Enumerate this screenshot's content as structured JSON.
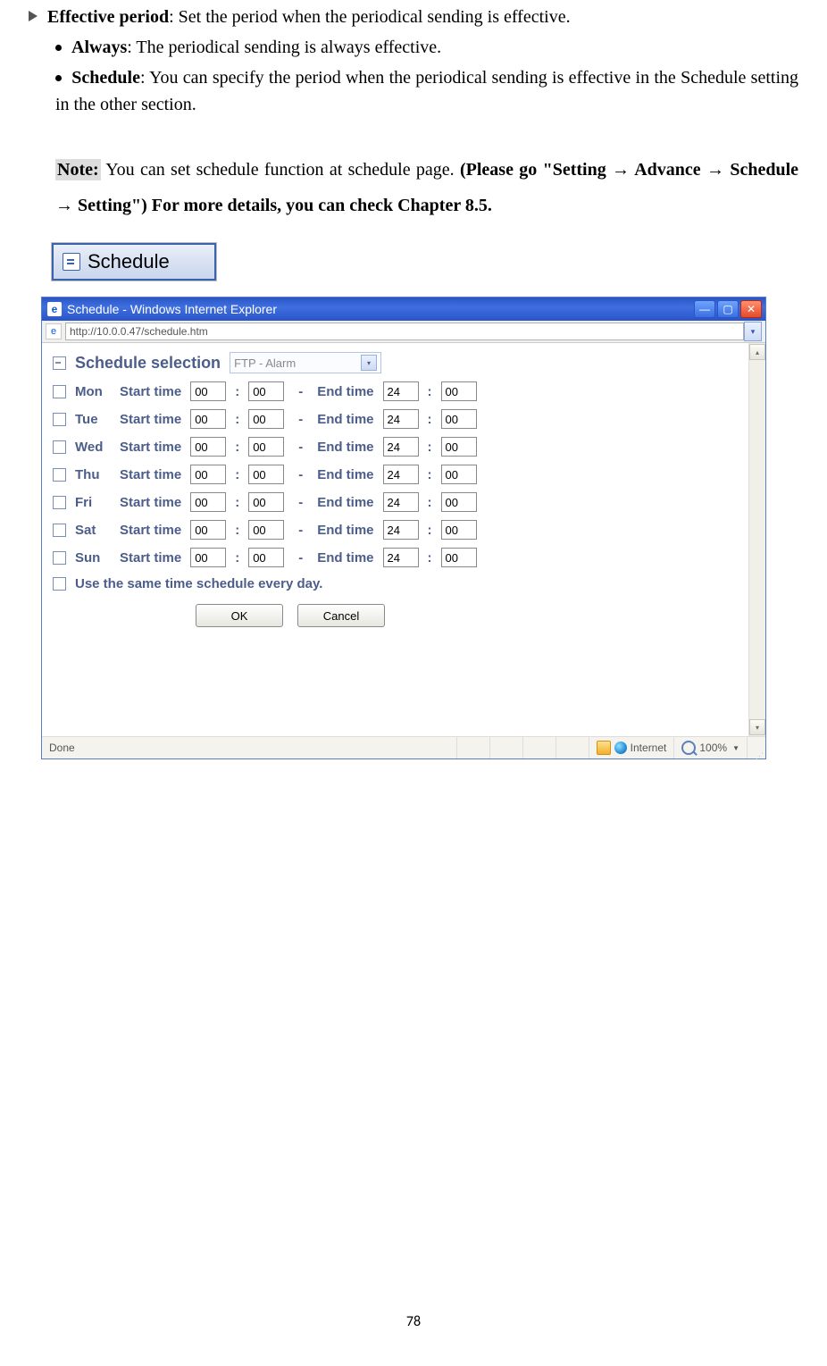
{
  "doc": {
    "line_effective": {
      "label": "Effective period",
      "text": ": Set the period when the periodical sending is effective."
    },
    "line_always": {
      "label": "Always",
      "text": ": The periodical sending is always effective."
    },
    "line_schedule": {
      "label": "Schedule",
      "text": ": You can specify the period when the periodical sending is effective in the Schedule setting in the other section."
    },
    "note_label": "Note:",
    "note_text1": " You can set schedule function at schedule page. ",
    "note_text2": "(Please go \"Setting → Advance → Schedule → Setting\") For more details, you can check Chapter 8.5.",
    "page_num": "78"
  },
  "tab_button": {
    "text": "Schedule"
  },
  "ie": {
    "title": "Schedule - Windows Internet Explorer",
    "url": "http://10.0.0.47/schedule.htm",
    "section_title": "Schedule selection",
    "select_value": "FTP - Alarm",
    "start_label": "Start time",
    "end_label": "End time",
    "same_label": "Use the same time schedule every day.",
    "ok": "OK",
    "cancel": "Cancel",
    "status_done": "Done",
    "status_zone": "Internet",
    "status_zoom": "100%",
    "days": [
      {
        "name": "Mon",
        "sh": "00",
        "sm": "00",
        "eh": "24",
        "em": "00"
      },
      {
        "name": "Tue",
        "sh": "00",
        "sm": "00",
        "eh": "24",
        "em": "00"
      },
      {
        "name": "Wed",
        "sh": "00",
        "sm": "00",
        "eh": "24",
        "em": "00"
      },
      {
        "name": "Thu",
        "sh": "00",
        "sm": "00",
        "eh": "24",
        "em": "00"
      },
      {
        "name": "Fri",
        "sh": "00",
        "sm": "00",
        "eh": "24",
        "em": "00"
      },
      {
        "name": "Sat",
        "sh": "00",
        "sm": "00",
        "eh": "24",
        "em": "00"
      },
      {
        "name": "Sun",
        "sh": "00",
        "sm": "00",
        "eh": "24",
        "em": "00"
      }
    ]
  }
}
